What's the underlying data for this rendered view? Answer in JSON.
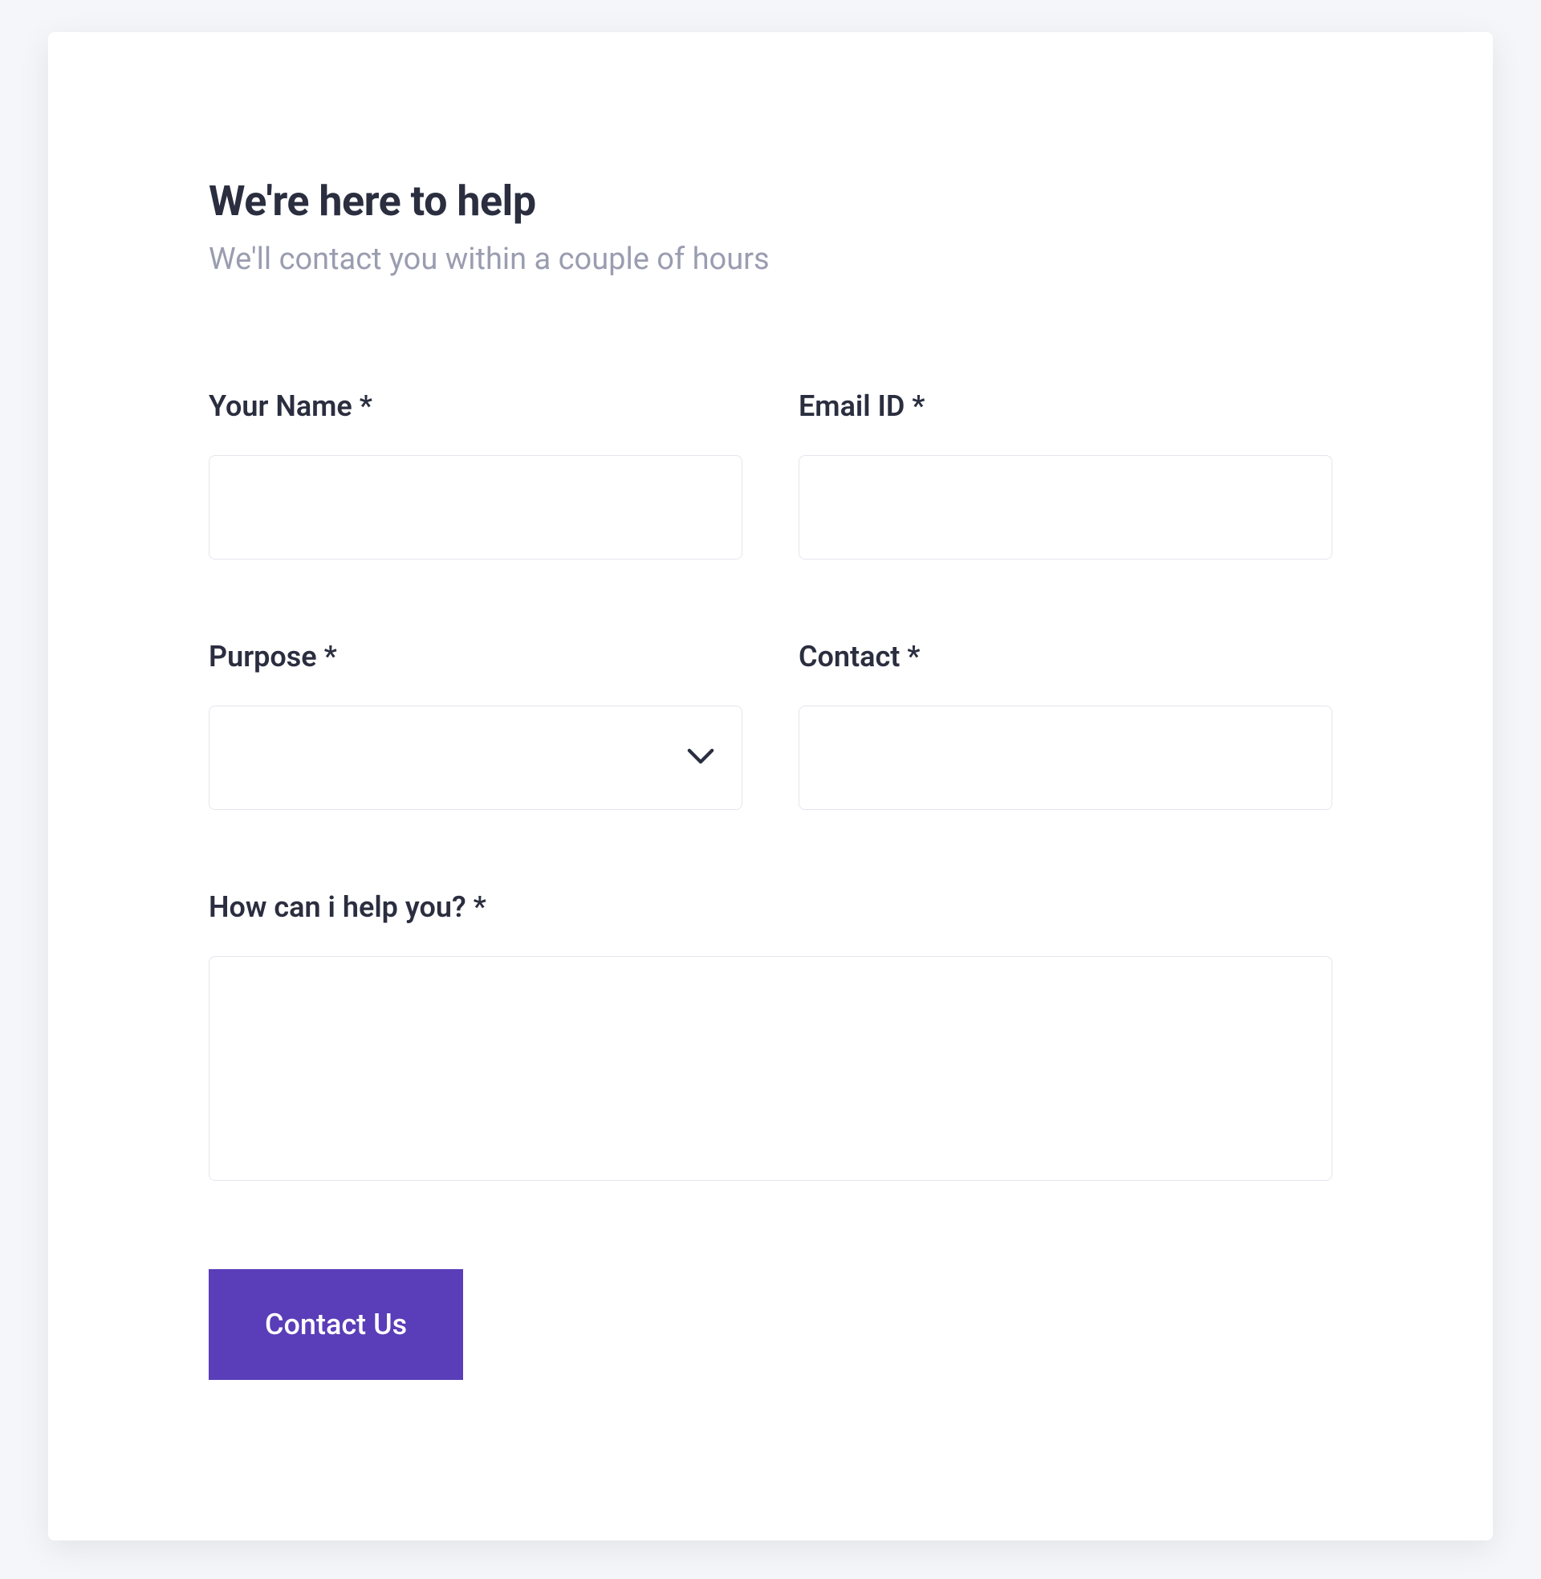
{
  "header": {
    "title": "We're here to help",
    "subtitle": "We'll contact you within a couple of hours"
  },
  "form": {
    "name": {
      "label": "Your Name *",
      "value": ""
    },
    "email": {
      "label": "Email ID *",
      "value": ""
    },
    "purpose": {
      "label": "Purpose *",
      "value": ""
    },
    "contact": {
      "label": "Contact *",
      "value": ""
    },
    "message": {
      "label": "How can i help you? *",
      "value": ""
    },
    "submit_label": "Contact Us"
  },
  "colors": {
    "accent": "#5a3db8",
    "text_primary": "#2a2e3f",
    "text_secondary": "#9a9db0",
    "border": "#e5e6ed"
  }
}
